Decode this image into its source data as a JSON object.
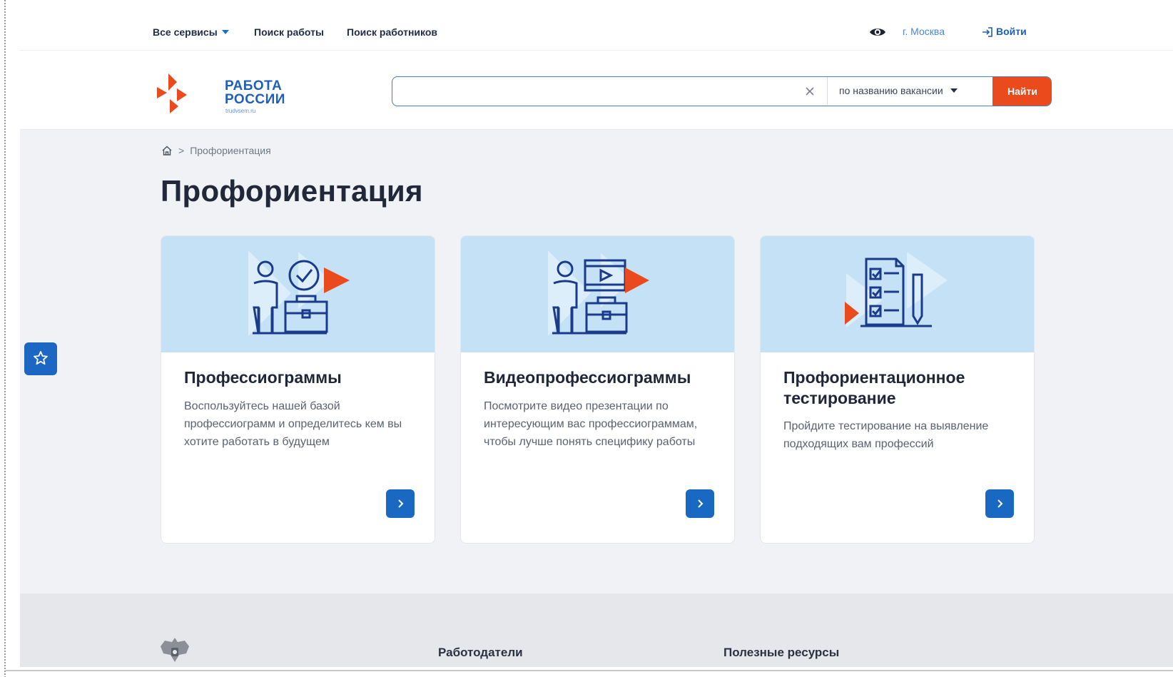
{
  "topnav": {
    "all_services": "Все сервисы",
    "job_search": "Поиск работы",
    "worker_search": "Поиск работников",
    "city": "г. Москва",
    "login": "Войти"
  },
  "header": {
    "logo_line1": "РАБОТА",
    "logo_line2": "РОССИИ",
    "logo_domain": "trudvsem.ru",
    "search_value": "",
    "search_mode": "по названию вакансии",
    "find_button": "Найти"
  },
  "breadcrumb": {
    "current": "Профориентация"
  },
  "page_title": "Профориентация",
  "cards": [
    {
      "title": "Профессиограммы",
      "description": "Воспользуйтесь нашей базой профессиограмм и определитесь кем вы хотите работать в будущем",
      "icon": "person-check-briefcase-icon"
    },
    {
      "title": "Видеопрофессиограммы",
      "description": "Посмотрите видео презентации по интересующим вас профессиограммам, чтобы лучше понять специфику работы",
      "icon": "person-video-briefcase-icon"
    },
    {
      "title": "Профориентационное тестирование",
      "description": "Пройдите тестирование на выявление подходящих вам профессий",
      "icon": "checklist-pen-icon"
    }
  ],
  "footer": {
    "col_employers": "Работодатели",
    "col_resources": "Полезные ресурсы"
  },
  "colors": {
    "brand_blue": "#1968c2",
    "accent_orange": "#ea4a1c",
    "card_image_bg": "#c5e1f6",
    "page_bg": "#f1f2f5"
  }
}
